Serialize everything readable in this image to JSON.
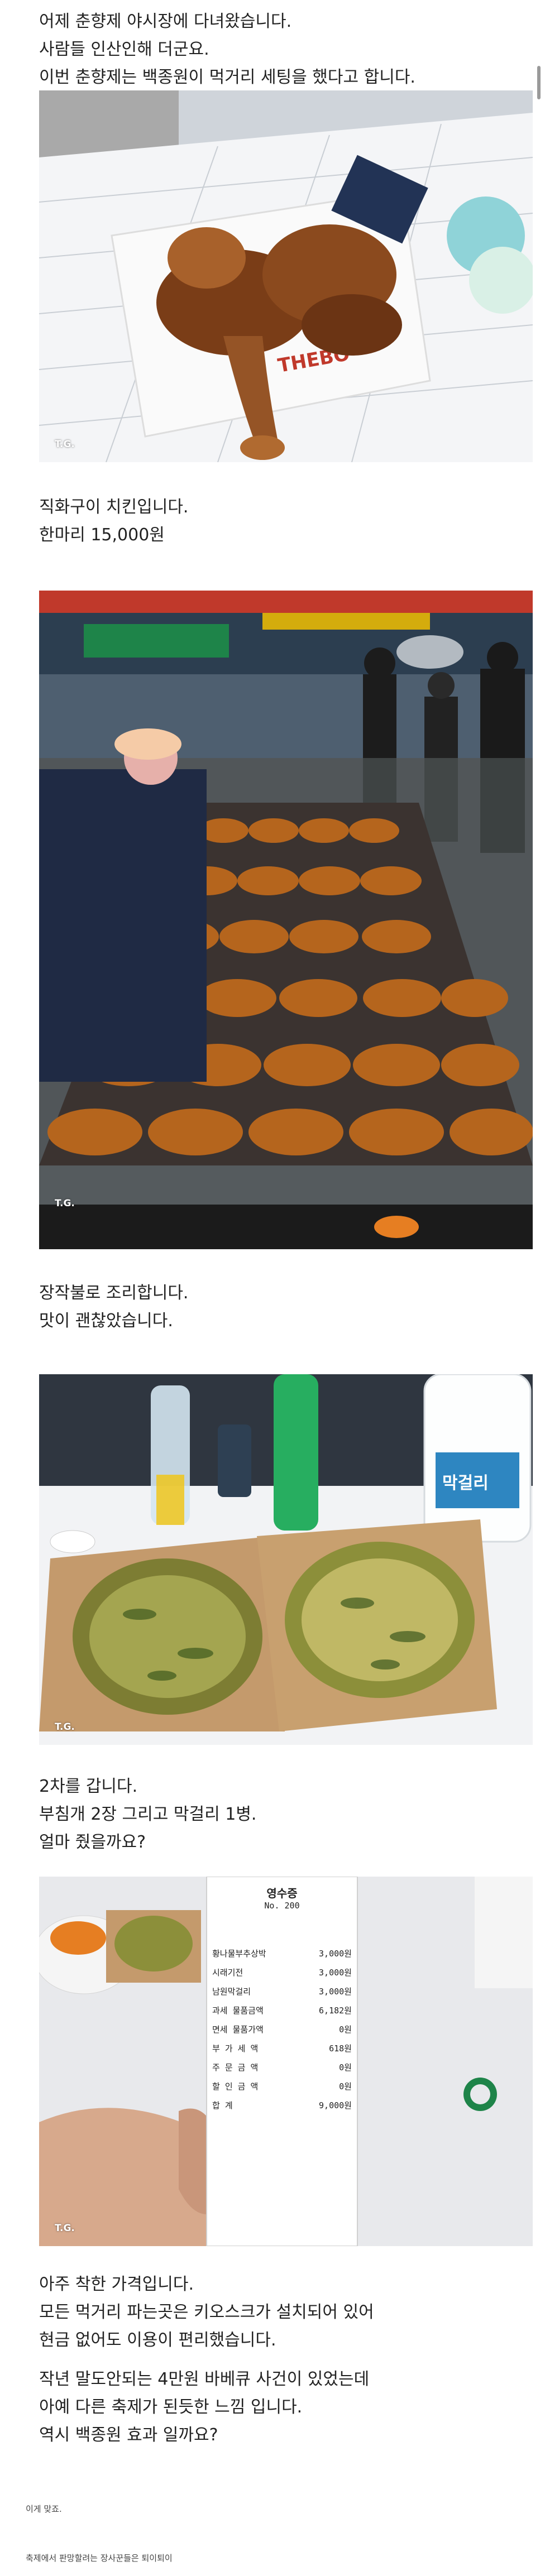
{
  "intro_lines": [
    "어제 춘향제 야시장에 다녀왔습니다.",
    "사람들 인산인해 더군요.",
    "이번 춘향제는 백종원이 먹거리 세팅을 했다고 합니다."
  ],
  "photo1": {
    "watermark": "T.G.",
    "plate_brand": "THEBO"
  },
  "section1_lines": [
    "직화구이 치킨입니다.",
    "한마리 15,000원"
  ],
  "photo2": {
    "watermark": "T.G."
  },
  "section2_lines": [
    "장작불로 조리합니다.",
    "맛이 괜찮았습니다."
  ],
  "photo3": {
    "watermark": "T.G.",
    "bottle_label": "막걸리"
  },
  "section3_lines": [
    "2차를 갑니다.",
    "부침개 2장 그리고 막걸리 1병.",
    "얼마 줬을까요?"
  ],
  "photo4": {
    "watermark": "T.G.",
    "receipt": {
      "title": "영수증",
      "table_no": "No. 200",
      "rows": [
        {
          "label": "황나물부추상박",
          "value": "3,000원"
        },
        {
          "label": "시래기전",
          "value": "3,000원"
        },
        {
          "label": "남원막걸리",
          "value": "3,000원"
        },
        {
          "label": "과세 물품금액",
          "value": "6,182원"
        },
        {
          "label": "면세 물품가액",
          "value": "0원"
        },
        {
          "label": "부 가 세 액",
          "value": "618원"
        },
        {
          "label": "주 문 금 액",
          "value": "0원"
        },
        {
          "label": "할 인 금 액",
          "value": "0원"
        },
        {
          "label": "합      계",
          "value": "9,000원"
        }
      ]
    }
  },
  "section4_lines": [
    "아주 착한 가격입니다.",
    "모든 먹거리 파는곳은 키오스크가 설치되어 있어",
    "현금 없어도 이용이 편리했습니다.",
    "",
    "작년 말도안되는 4만원 바베큐 사건이 있었는데",
    "아예 다른 축제가 된듯한 느낌 입니다.",
    "역시 백종원 효과 일까요?"
  ],
  "note_line": "이게 맞죠.",
  "footer_line": "축제에서 판망할려는 장사꾼들은 퇴이퇴이",
  "colors": {
    "text": "#222222",
    "background": "#ffffff",
    "caption": "#ffffff"
  }
}
